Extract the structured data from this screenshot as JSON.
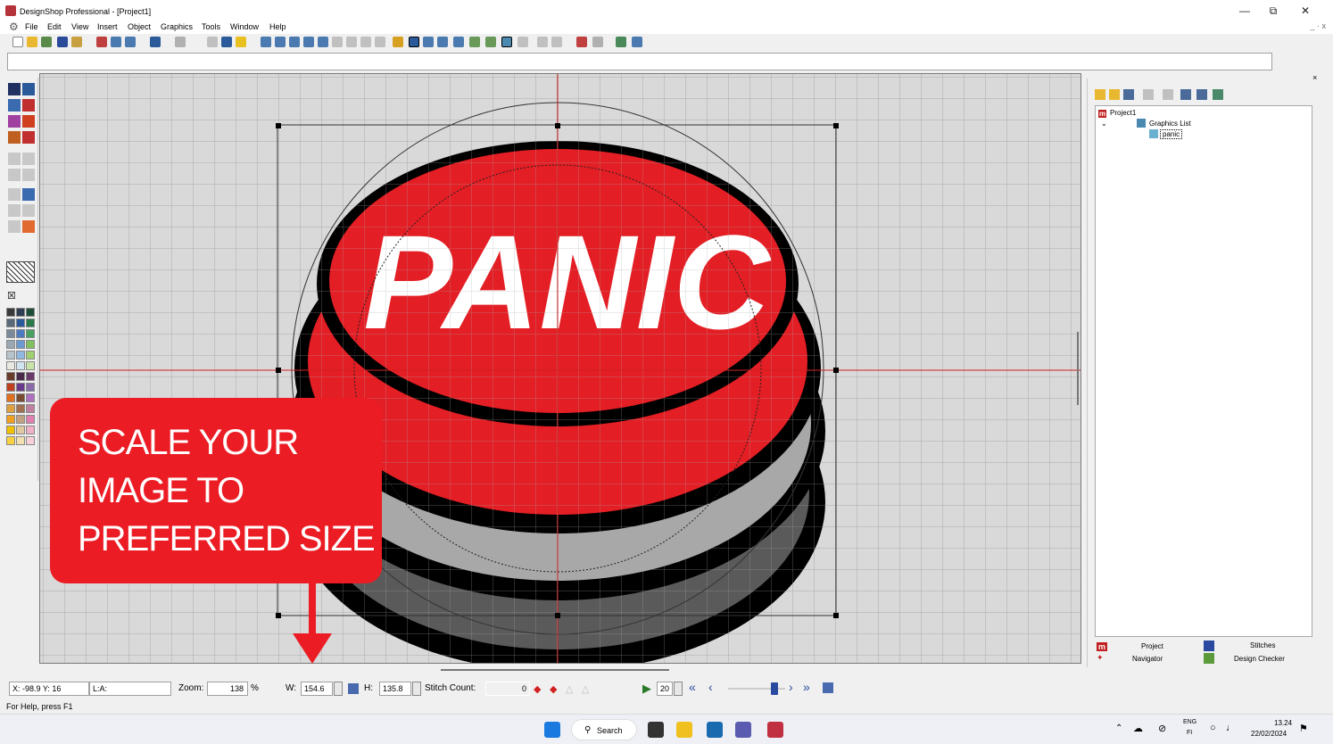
{
  "window": {
    "title": "DesignShop Professional - [Project1]",
    "minimize_glyph": "—",
    "maximize_glyph": "⧉",
    "close_glyph": "✕",
    "mdi_controls": "_ · x"
  },
  "menu": [
    "File",
    "Edit",
    "View",
    "Insert",
    "Object",
    "Graphics",
    "Tools",
    "Window",
    "Help"
  ],
  "canvas": {
    "artwork_text": "PANIC",
    "colors": {
      "button_red": "#e31e24",
      "outline": "#000000",
      "light_gray": "#a8a8a8",
      "dark_gray": "#5a5a5a",
      "grid": "#aaaaaa",
      "guide": "#d02020"
    }
  },
  "tree": {
    "project": "Project1",
    "graphics_list": "Graphics List",
    "item": "panic"
  },
  "panel_tabs": {
    "project": "Project",
    "stitches": "Stitches",
    "navigator": "Navigator",
    "design_checker": "Design Checker"
  },
  "callout": {
    "lines": [
      "SCALE YOUR",
      "IMAGE TO",
      "PREFERRED SIZE"
    ],
    "color": "#ec1c24"
  },
  "status": {
    "coords": "X: -98.9  Y: 16",
    "layer": "L:A:",
    "zoom_label": "Zoom:",
    "zoom_value": "138",
    "zoom_unit": "%",
    "w_label": "W:",
    "w_value": "154.6",
    "h_label": "H:",
    "h_value": "135.8",
    "stitch_label": "Stitch Count:",
    "stitch_value": "0",
    "speed_value": "20",
    "help": "For Help, press F1"
  },
  "taskbar": {
    "search": "Search",
    "lang_top": "ENG",
    "lang_bottom": "FI",
    "time": "13.24",
    "date": "22/02/2024"
  },
  "palette": [
    "#3a3a3a",
    "#2f3e52",
    "#1f4e38",
    "#5a6a7a",
    "#2a5a9a",
    "#2a7a4a",
    "#7a8a9a",
    "#4a7ac0",
    "#4aa060",
    "#9aa8b4",
    "#6a9ad0",
    "#80c060",
    "#b8c4cc",
    "#90b8e0",
    "#a0d070",
    "#e8e8e0",
    "#d0e4f0",
    "#c8e4a8",
    "#6a3a2a",
    "#4a2a4a",
    "#6a3a6a",
    "#c04020",
    "#6a3a8a",
    "#8a6aa8",
    "#e07020",
    "#7a4a30",
    "#b070c0",
    "#e0a040",
    "#a07050",
    "#c080a0",
    "#f0a020",
    "#c0a080",
    "#e080b0",
    "#f0c000",
    "#e0c8a0",
    "#f0b0c8",
    "#f8d040",
    "#f0e0b0",
    "#f8d0d8"
  ]
}
